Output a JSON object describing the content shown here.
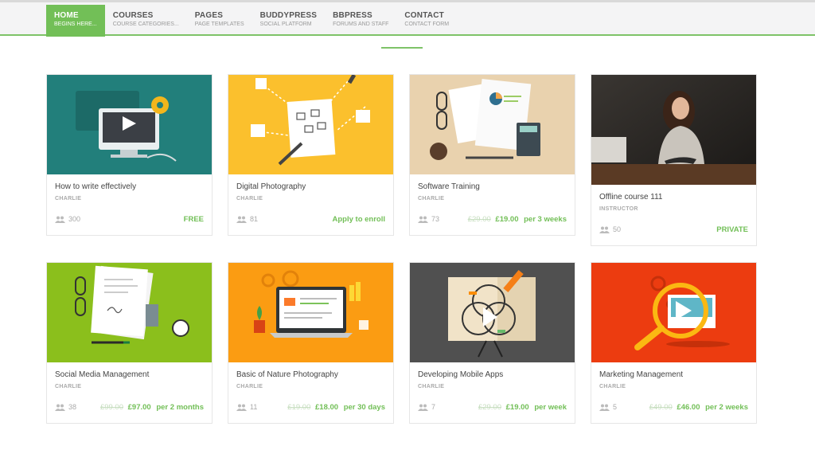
{
  "nav": {
    "items": [
      {
        "label": "HOME",
        "sub": "BEGINS HERE..."
      },
      {
        "label": "COURSES",
        "sub": "COURSE CATEGORIES..."
      },
      {
        "label": "PAGES",
        "sub": "PAGE TEMPLATES"
      },
      {
        "label": "BUDDYPRESS",
        "sub": "SOCIAL PLATFORM"
      },
      {
        "label": "BBPRESS",
        "sub": "FORUMS AND STAFF"
      },
      {
        "label": "CONTACT",
        "sub": "CONTACT FORM"
      }
    ]
  },
  "courses": [
    {
      "title": "How to write effectively",
      "author": "CHARLIE",
      "students": "300",
      "price": "FREE",
      "thumb": "monitor-gear-illustration"
    },
    {
      "title": "Digital Photography",
      "author": "CHARLIE",
      "students": "81",
      "price": "Apply to enroll",
      "thumb": "sketch-diagram-illustration"
    },
    {
      "title": "Software Training",
      "author": "CHARLIE",
      "students": "73",
      "old_price": "£29.00",
      "price": "£19.00",
      "period": "per 3 weeks",
      "thumb": "desk-documents-illustration"
    },
    {
      "title": "Offline course 111",
      "author": "INSTRUCTOR",
      "students": "50",
      "price": "PRIVATE",
      "thumb": "woman-tablet-photo"
    },
    {
      "title": "Social Media Management",
      "author": "CHARLIE",
      "students": "38",
      "old_price": "£99.00",
      "price": "£97.00",
      "period": "per 2 months",
      "thumb": "paper-glasses-illustration"
    },
    {
      "title": "Basic of Nature Photography",
      "author": "CHARLIE",
      "students": "11",
      "old_price": "£19.00",
      "price": "£18.00",
      "period": "per 30 days",
      "thumb": "laptop-code-illustration"
    },
    {
      "title": "Developing Mobile Apps",
      "author": "CHARLIE",
      "students": "7",
      "old_price": "£29.00",
      "price": "£19.00",
      "period": "per week",
      "thumb": "easel-venn-illustration"
    },
    {
      "title": "Marketing Management",
      "author": "CHARLIE",
      "students": "5",
      "old_price": "£49.00",
      "price": "£46.00",
      "period": "per 2 weeks",
      "thumb": "magnifier-video-illustration"
    }
  ],
  "colors": {
    "accent": "#72bf57",
    "teal": "#227f7b",
    "yellow": "#fbc02d",
    "sand": "#e9d2ae",
    "lime": "#8bbf1c",
    "orange": "#fb9c12",
    "slate": "#505050",
    "red": "#ec3c10"
  }
}
